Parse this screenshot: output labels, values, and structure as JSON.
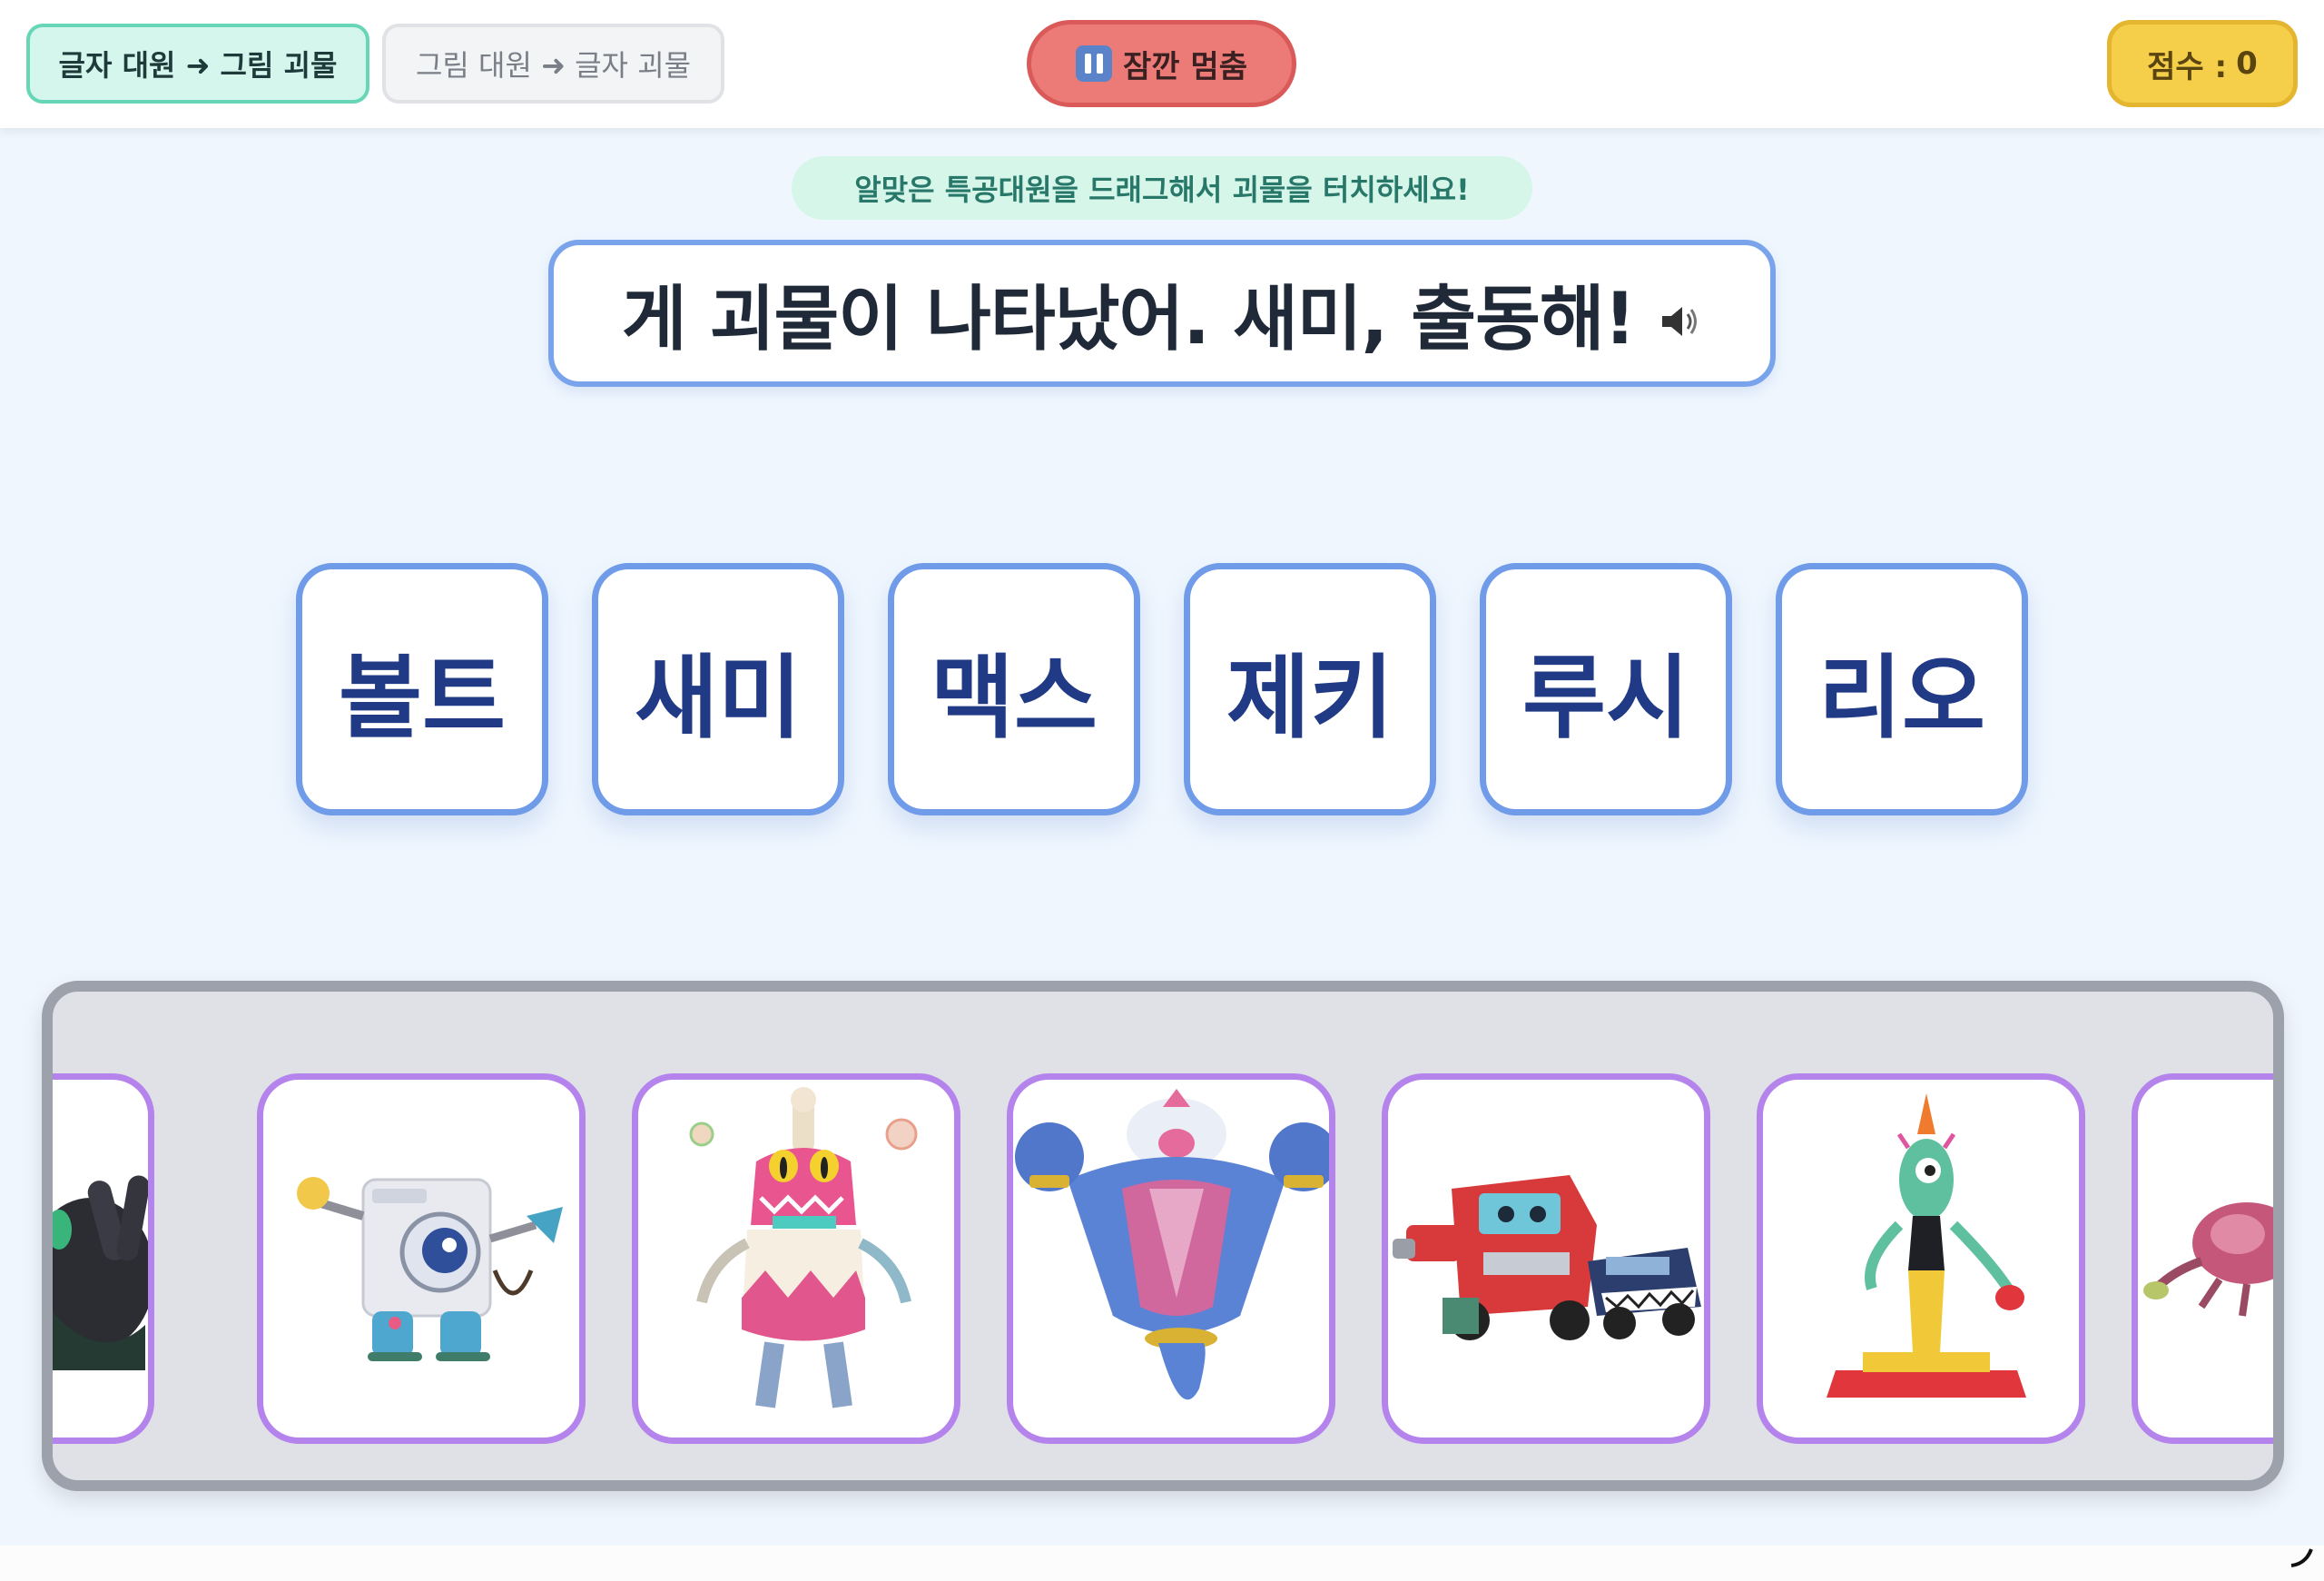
{
  "header": {
    "mode_word_to_picture": "글자 대원 ➜ 그림 괴물",
    "mode_picture_to_word": "그림 대원 ➜ 글자 괴물",
    "pause_label": "잠깐 멈춤",
    "score_label": "점수 :",
    "score_value": "0"
  },
  "instruction": "알맞은 특공대원을 드래그해서 괴물을 터치하세요!",
  "prompt": {
    "text": "게 괴물이 나타났어. 새미, 출동해!",
    "icon": "speaker-icon"
  },
  "agents": [
    {
      "label": "볼트"
    },
    {
      "label": "새미"
    },
    {
      "label": "맥스"
    },
    {
      "label": "제키"
    },
    {
      "label": "루시"
    },
    {
      "label": "리오"
    }
  ],
  "monsters": [
    {
      "name": "hand-monster"
    },
    {
      "name": "washing-machine-monster"
    },
    {
      "name": "pink-bottle-monster"
    },
    {
      "name": "blue-genie-monster"
    },
    {
      "name": "truck-monster"
    },
    {
      "name": "green-vacuum-monster"
    },
    {
      "name": "crab-monster"
    }
  ],
  "colors": {
    "background": "#eff6fe",
    "agent_border": "#6f9be9",
    "agent_text": "#203a86",
    "monster_border": "#b583ec",
    "pause_button": "#ec7b78",
    "score_badge": "#f6cf4a",
    "mode_active": "#d5f6ec"
  }
}
